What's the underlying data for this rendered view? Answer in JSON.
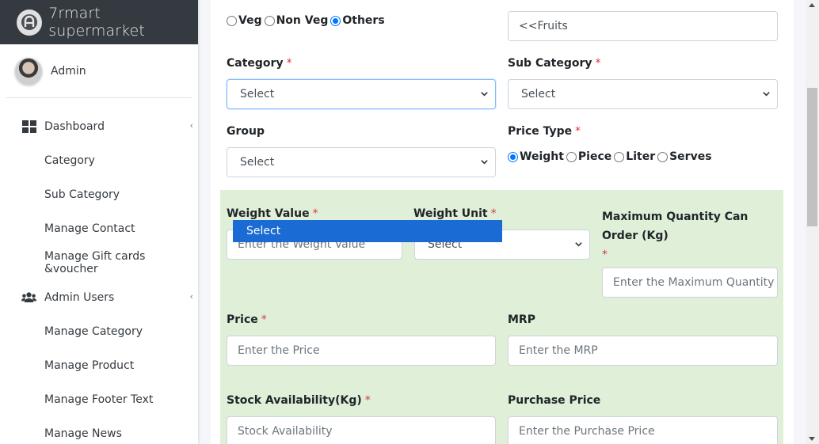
{
  "brand": {
    "name": "7rmart supermarket",
    "logo_icon": "brand-logo-icon"
  },
  "user": {
    "name": "Admin"
  },
  "sidebar": {
    "items": [
      {
        "label": "Dashboard",
        "icon": "dashboard-grid-icon",
        "level": "top",
        "caret": "‹"
      },
      {
        "label": "Category",
        "level": "sub"
      },
      {
        "label": "Sub Category",
        "level": "sub"
      },
      {
        "label": "Manage Contact",
        "level": "sub"
      },
      {
        "label": "Manage Gift cards &voucher",
        "level": "sub"
      },
      {
        "label": "Admin Users",
        "icon": "users-icon",
        "level": "top",
        "caret": "‹"
      },
      {
        "label": "Manage Category",
        "level": "sub"
      },
      {
        "label": "Manage Product",
        "level": "sub"
      },
      {
        "label": "Manage Footer Text",
        "level": "sub"
      },
      {
        "label": "Manage News",
        "level": "sub"
      }
    ]
  },
  "form": {
    "type_radios": {
      "options": [
        "Veg",
        "Non Veg",
        "Others"
      ],
      "selected": "Others"
    },
    "tag_value": "<<Fruits",
    "category": {
      "label": "Category",
      "required": "*",
      "value": "Select"
    },
    "sub_category": {
      "label": "Sub Category",
      "required": "*",
      "value": "Select"
    },
    "group": {
      "label": "Group",
      "value": "Select"
    },
    "price_type": {
      "label": "Price Type",
      "required": "*",
      "options": [
        "Weight",
        "Piece",
        "Liter",
        "Serves"
      ],
      "selected": "Weight"
    },
    "weight_value": {
      "label": "Weight Value",
      "required": "*",
      "placeholder": "Enter the Weight Value"
    },
    "weight_unit": {
      "label": "Weight Unit",
      "required": "*",
      "value": "Select",
      "dropdown_option": "Select"
    },
    "max_quantity": {
      "label": "Maximum Quantity Can Order (Kg)",
      "required": "*",
      "placeholder": "Enter the Maximum Quantity"
    },
    "price": {
      "label": "Price",
      "required": "*",
      "placeholder": "Enter the Price"
    },
    "mrp": {
      "label": "MRP",
      "placeholder": "Enter the MRP"
    },
    "stock": {
      "label": "Stock Availability(Kg)",
      "required": "*",
      "placeholder": "Stock Availability"
    },
    "purchase_price": {
      "label": "Purchase Price",
      "placeholder": "Enter the Purchase Price"
    }
  },
  "colors": {
    "brand_bar": "#343a40",
    "panel_green": "#dfefd8",
    "required": "#dc3545",
    "dropdown_highlight": "#1a6bd3",
    "radio_accent": "#0075ff"
  }
}
